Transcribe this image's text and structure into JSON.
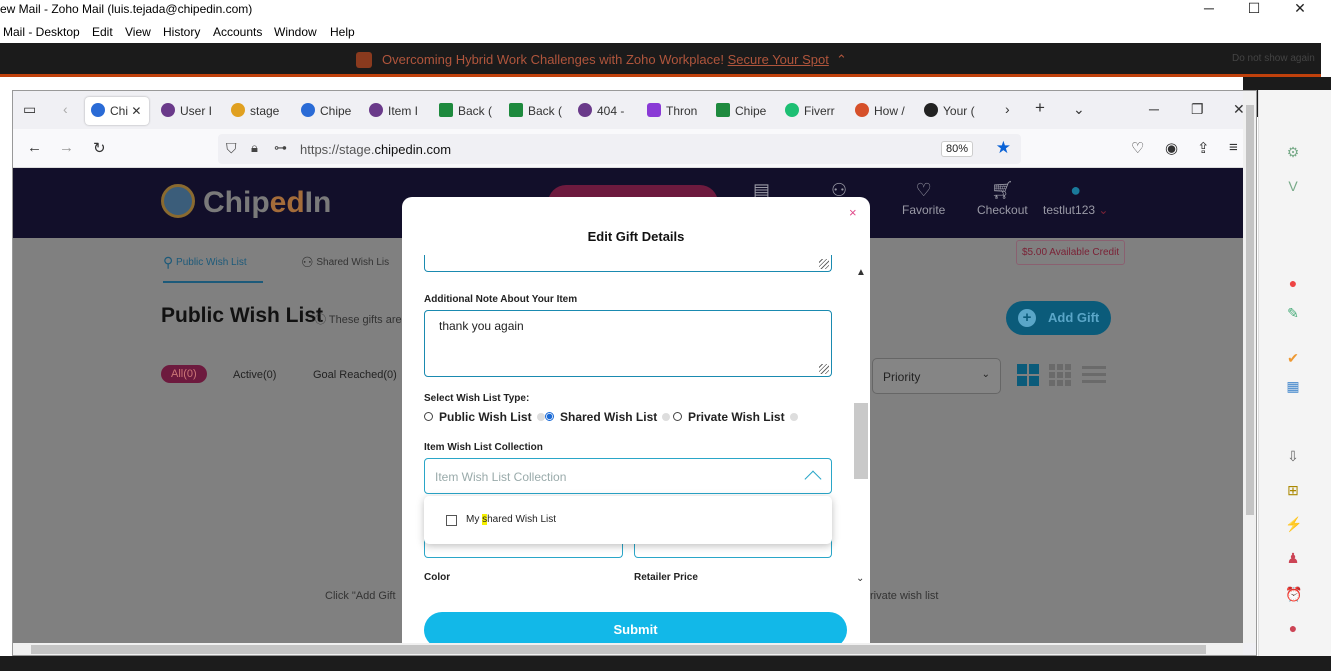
{
  "outer_window": {
    "title": "ew Mail - Zoho Mail (luis.tejada@chipedin.com)",
    "minimize": "─",
    "maximize": "☐",
    "close": "✕",
    "menu": [
      "Mail - Desktop",
      "Edit",
      "View",
      "History",
      "Accounts",
      "Window",
      "Help"
    ]
  },
  "promo": {
    "text": "Overcoming Hybrid Work Challenges with Zoho Workplace!",
    "link": "Secure Your Spot",
    "dismiss": "Do not show again"
  },
  "browser": {
    "tabs": [
      {
        "label": "Chi",
        "active": true,
        "color": "#2a6bd6"
      },
      {
        "label": "User I",
        "active": false,
        "color": "#6a3a8a"
      },
      {
        "label": "stage",
        "active": false,
        "color": "#e0a020"
      },
      {
        "label": "Chipe",
        "active": false,
        "color": "#2a6bd6"
      },
      {
        "label": "Item I",
        "active": false,
        "color": "#6a3a8a"
      },
      {
        "label": "Back (",
        "active": false,
        "color": "#1e8a3e"
      },
      {
        "label": "Back (",
        "active": false,
        "color": "#1e8a3e"
      },
      {
        "label": "404 -",
        "active": false,
        "color": "#6a3a8a"
      },
      {
        "label": "Thron",
        "active": false,
        "color": "#8a3ad6"
      },
      {
        "label": "Chipe",
        "active": false,
        "color": "#1e8a3e"
      },
      {
        "label": "Fiverr",
        "active": false,
        "color": "#1dbf73"
      },
      {
        "label": "How /",
        "active": false,
        "color": "#d6502a"
      },
      {
        "label": "Your (",
        "active": false,
        "color": "#222222"
      }
    ],
    "url_prefix": "https://stage.",
    "url_domain": "chipedin.com",
    "zoom": "80%"
  },
  "site": {
    "logo_a": "Chip",
    "logo_b": "ed",
    "logo_c": "In",
    "nav": [
      "Favorite",
      "Checkout",
      "testlut123"
    ],
    "credit": "$5.00 Available Credit",
    "tabs": [
      "Public Wish List",
      "Shared Wish Lis"
    ],
    "title": "Public Wish List",
    "subtitle": "These gifts are",
    "add_gift": "Add Gift",
    "filters": [
      "All(0)",
      "Active(0)",
      "Goal Reached(0)"
    ],
    "priority": "Priority",
    "empty_left": "Click \"Add Gift",
    "empty_right": "rivate wish list"
  },
  "modal": {
    "title": "Edit Gift Details",
    "close": "×",
    "note_label": "Additional Note About Your Item",
    "note_value": "thank you again",
    "type_label": "Select Wish List Type:",
    "types": [
      {
        "label": "Public Wish List",
        "selected": false
      },
      {
        "label": "Shared Wish List",
        "selected": true
      },
      {
        "label": "Private Wish List",
        "selected": false
      }
    ],
    "collection_label": "Item Wish List Collection",
    "collection_placeholder": "Item Wish List Collection",
    "dropdown_option_a": "My ",
    "dropdown_option_hl": "s",
    "dropdown_option_b": "hared Wish List",
    "color_label": "Color",
    "price_label": "Retailer Price",
    "submit": "Submit"
  }
}
